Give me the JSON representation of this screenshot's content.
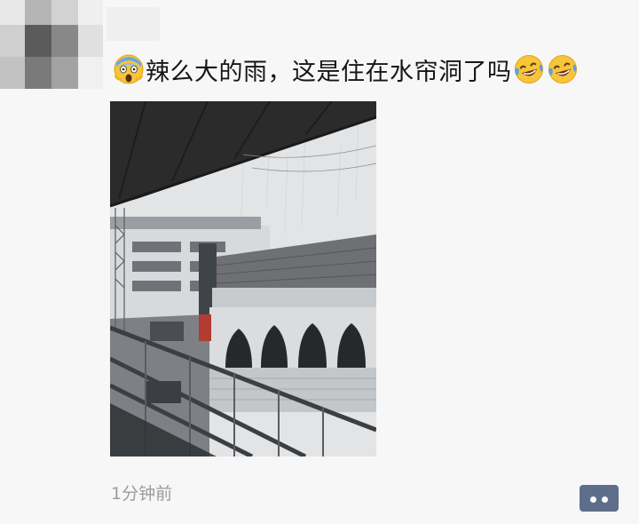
{
  "post": {
    "caption_text": "辣么大的雨，这是住在水帘洞了吗",
    "timestamp": "1分钟前",
    "emoji": {
      "lead": "face-screaming-in-fear-icon",
      "trail": [
        "crying-laughing-face-icon",
        "crying-laughing-face-icon"
      ]
    },
    "photo": {
      "subject": "rainy street viewed from balcony under eave",
      "colors": {
        "sky": "#e2e4e6",
        "eave": "#2b2b2b",
        "building": "#d8dadd",
        "arches": "#26292b"
      }
    }
  },
  "colors": {
    "background": "#f7f7f7",
    "caption_text": "#161616",
    "timestamp_text": "#9b9b9b",
    "comment_button": "#5e6e8a"
  }
}
